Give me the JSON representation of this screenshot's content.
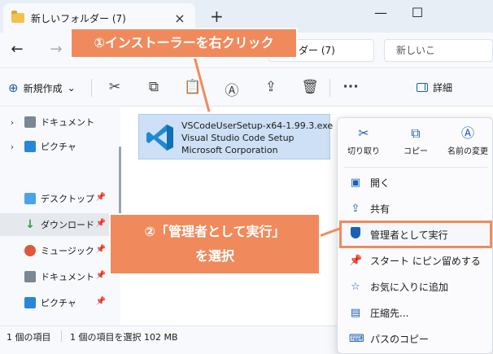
{
  "tab": {
    "title": "新しいフォルダー (7)",
    "close_icon": "×",
    "new_tab_icon": "+"
  },
  "window_controls": {
    "minimize": "—",
    "maximize": "☐"
  },
  "address": {
    "back_icon": "←",
    "forward_icon": "→",
    "path_visible": "ダー (7)",
    "search_placeholder": "新しいこ"
  },
  "toolbar": {
    "new_label": "新規作成",
    "new_chevron": "⌄",
    "cut_icon": "✂",
    "copy_icon": "⧉",
    "paste_icon": "📋",
    "rename_icon": "Ⓐ",
    "share_icon": "⇪",
    "delete_icon": "🗑",
    "more_icon": "···",
    "details_label": "詳細"
  },
  "sidebar": {
    "items": [
      {
        "label": "ドキュメント",
        "chevron": "›",
        "pin": ""
      },
      {
        "label": "ピクチャ",
        "chevron": "›",
        "pin": ""
      },
      {
        "label": "デスクトップ",
        "chevron": "",
        "pin": "📌"
      },
      {
        "label": "ダウンロード",
        "chevron": "",
        "pin": "📌"
      },
      {
        "label": "ミュージック",
        "chevron": "",
        "pin": "📌"
      },
      {
        "label": "ドキュメント",
        "chevron": "",
        "pin": "📌"
      },
      {
        "label": "ピクチャ",
        "chevron": "",
        "pin": "📌"
      }
    ],
    "download_glyph": "↓"
  },
  "file": {
    "name": "VSCodeUserSetup-x64-1.99.3.exe",
    "description": "Visual Studio Code Setup",
    "company": "Microsoft Corporation"
  },
  "status": {
    "count": "1 個の項目",
    "selected": "1 個の項目を選択 102 MB"
  },
  "context_menu": {
    "top": [
      {
        "label": "切り取り",
        "icon": "✂"
      },
      {
        "label": "コピー",
        "icon": "⧉"
      },
      {
        "label": "名前の変更",
        "icon": "Ⓐ"
      }
    ],
    "items": [
      {
        "label": "開く",
        "icon": "▣"
      },
      {
        "label": "共有",
        "icon": "⇪"
      },
      {
        "label": "管理者として実行",
        "icon": "shield"
      },
      {
        "label": "スタート にピン留めする",
        "icon": "📌"
      },
      {
        "label": "お気に入りに追加",
        "icon": "☆"
      },
      {
        "label": "圧縮先...",
        "icon": "▤"
      },
      {
        "label": "パスのコピー",
        "icon": "⌨"
      }
    ]
  },
  "callouts": {
    "step1": "①インストーラーを右クリック",
    "step2_line1": "②「管理者として実行」",
    "step2_line2": "を選択"
  },
  "colors": {
    "accent": "#1a5fb4",
    "callout": "#f08a5d",
    "selection": "#cde0f5"
  }
}
